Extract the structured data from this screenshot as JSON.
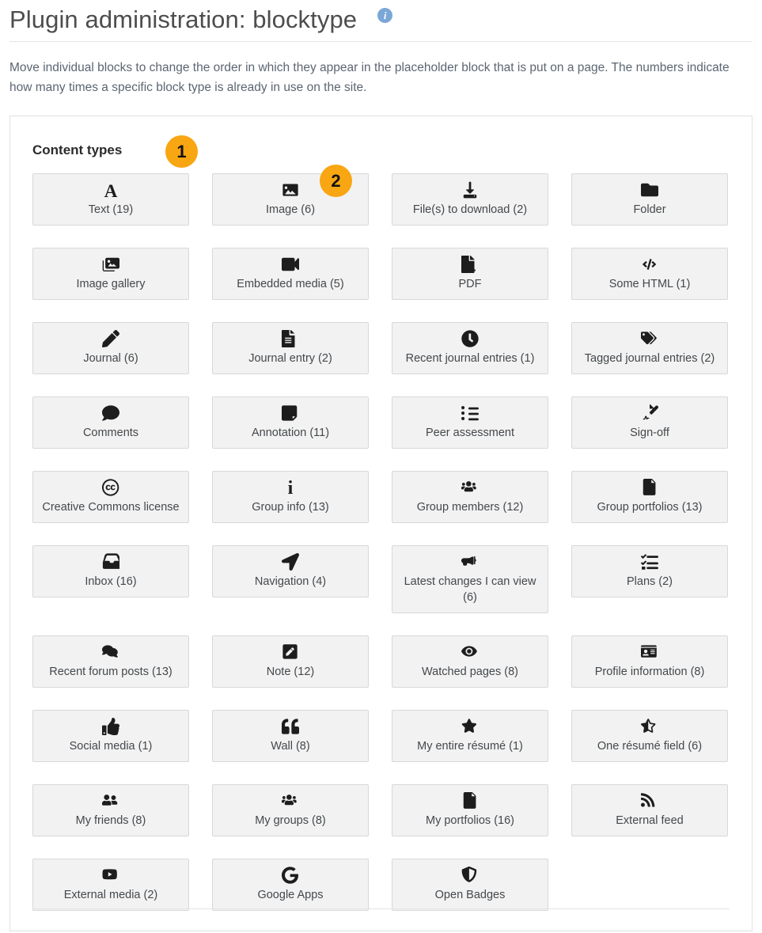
{
  "header": {
    "title": "Plugin administration: blocktype",
    "info_icon": "info-icon",
    "info_tooltip": "i"
  },
  "intro": "Move individual blocks to change the order in which they appear in the placeholder block that is put on a page. The numbers indicate how many times a specific block type is already in use on the site.",
  "section": {
    "title": "Content types"
  },
  "markers": [
    {
      "id": 1,
      "label": "1",
      "color": "#f9a613"
    },
    {
      "id": 2,
      "label": "2",
      "color": "#f9a613"
    }
  ],
  "colors": {
    "marker": "#f9a613",
    "tile_bg": "#f2f2f2",
    "tile_border": "#d8d8d8",
    "info_badge": "#7ba7d7",
    "title_text": "#4d4d4d",
    "body_text": "#5b6672"
  },
  "tiles": [
    {
      "label": "Text (19)",
      "icon": "letter-a-icon"
    },
    {
      "label": "Image (6)",
      "icon": "image-icon"
    },
    {
      "label": "File(s) to download (2)",
      "icon": "download-icon"
    },
    {
      "label": "Folder",
      "icon": "folder-icon"
    },
    {
      "label": "Image gallery",
      "icon": "image-gallery-icon"
    },
    {
      "label": "Embedded media (5)",
      "icon": "video-camera-icon"
    },
    {
      "label": "PDF",
      "icon": "pdf-file-icon"
    },
    {
      "label": "Some HTML (1)",
      "icon": "code-icon"
    },
    {
      "label": "Journal (6)",
      "icon": "pencil-icon"
    },
    {
      "label": "Journal entry (2)",
      "icon": "file-lines-icon"
    },
    {
      "label": "Recent journal entries (1)",
      "icon": "clock-icon"
    },
    {
      "label": "Tagged journal entries (2)",
      "icon": "tags-icon"
    },
    {
      "label": "Comments",
      "icon": "comment-icon"
    },
    {
      "label": "Annotation (11)",
      "icon": "note-sticky-icon"
    },
    {
      "label": "Peer assessment",
      "icon": "list-icon"
    },
    {
      "label": "Sign-off",
      "icon": "file-signature-icon"
    },
    {
      "label": "Creative Commons license",
      "icon": "creative-commons-icon"
    },
    {
      "label": "Group info (13)",
      "icon": "info-letter-icon"
    },
    {
      "label": "Group members (12)",
      "icon": "users-group-icon"
    },
    {
      "label": "Group portfolios (13)",
      "icon": "file-icon"
    },
    {
      "label": "Inbox (16)",
      "icon": "inbox-icon"
    },
    {
      "label": "Navigation (4)",
      "icon": "location-arrow-icon"
    },
    {
      "label": "Latest changes I can view (6)",
      "icon": "bullhorn-icon"
    },
    {
      "label": "Plans (2)",
      "icon": "tasks-list-icon"
    },
    {
      "label": "Recent forum posts (13)",
      "icon": "comments-icon"
    },
    {
      "label": "Note (12)",
      "icon": "pen-square-icon"
    },
    {
      "label": "Watched pages (8)",
      "icon": "eye-icon"
    },
    {
      "label": "Profile information (8)",
      "icon": "id-card-icon"
    },
    {
      "label": "Social media (1)",
      "icon": "thumbs-up-icon"
    },
    {
      "label": "Wall (8)",
      "icon": "quote-left-icon"
    },
    {
      "label": "My entire résumé (1)",
      "icon": "star-solid-icon"
    },
    {
      "label": "One résumé field (6)",
      "icon": "star-half-icon"
    },
    {
      "label": "My friends (8)",
      "icon": "user-friends-icon"
    },
    {
      "label": "My groups (8)",
      "icon": "users-group-icon"
    },
    {
      "label": "My portfolios (16)",
      "icon": "file-icon"
    },
    {
      "label": "External feed",
      "icon": "rss-icon"
    },
    {
      "label": "External media (2)",
      "icon": "youtube-icon"
    },
    {
      "label": "Google Apps",
      "icon": "google-g-icon"
    },
    {
      "label": "Open Badges",
      "icon": "shield-icon"
    }
  ]
}
